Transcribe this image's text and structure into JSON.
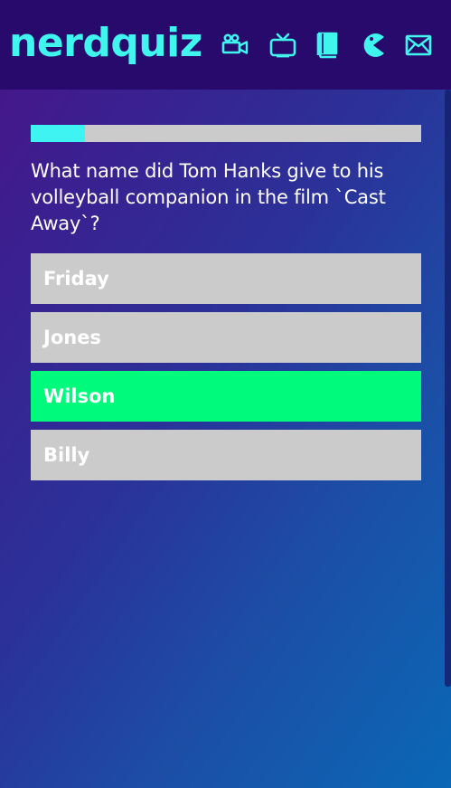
{
  "app": {
    "logo": "nerdquiz"
  },
  "nav": {
    "icons": [
      "video-camera-icon",
      "tv-icon",
      "book-icon",
      "pacman-icon",
      "mail-icon"
    ],
    "accent_color": "#40f5ee"
  },
  "progress": {
    "fraction": 0.14
  },
  "question": {
    "text": "What name did Tom Hanks give to his volleyball companion in the film `Cast Away`?"
  },
  "answers": [
    {
      "label": "Friday",
      "state": "default"
    },
    {
      "label": "Jones",
      "state": "default"
    },
    {
      "label": "Wilson",
      "state": "correct"
    },
    {
      "label": "Billy",
      "state": "default"
    }
  ],
  "colors": {
    "header_bg": "#270a6c",
    "answer_default": "#cbcbcb",
    "answer_correct": "#00fb7c",
    "progress_fill": "#3ff3f2"
  }
}
